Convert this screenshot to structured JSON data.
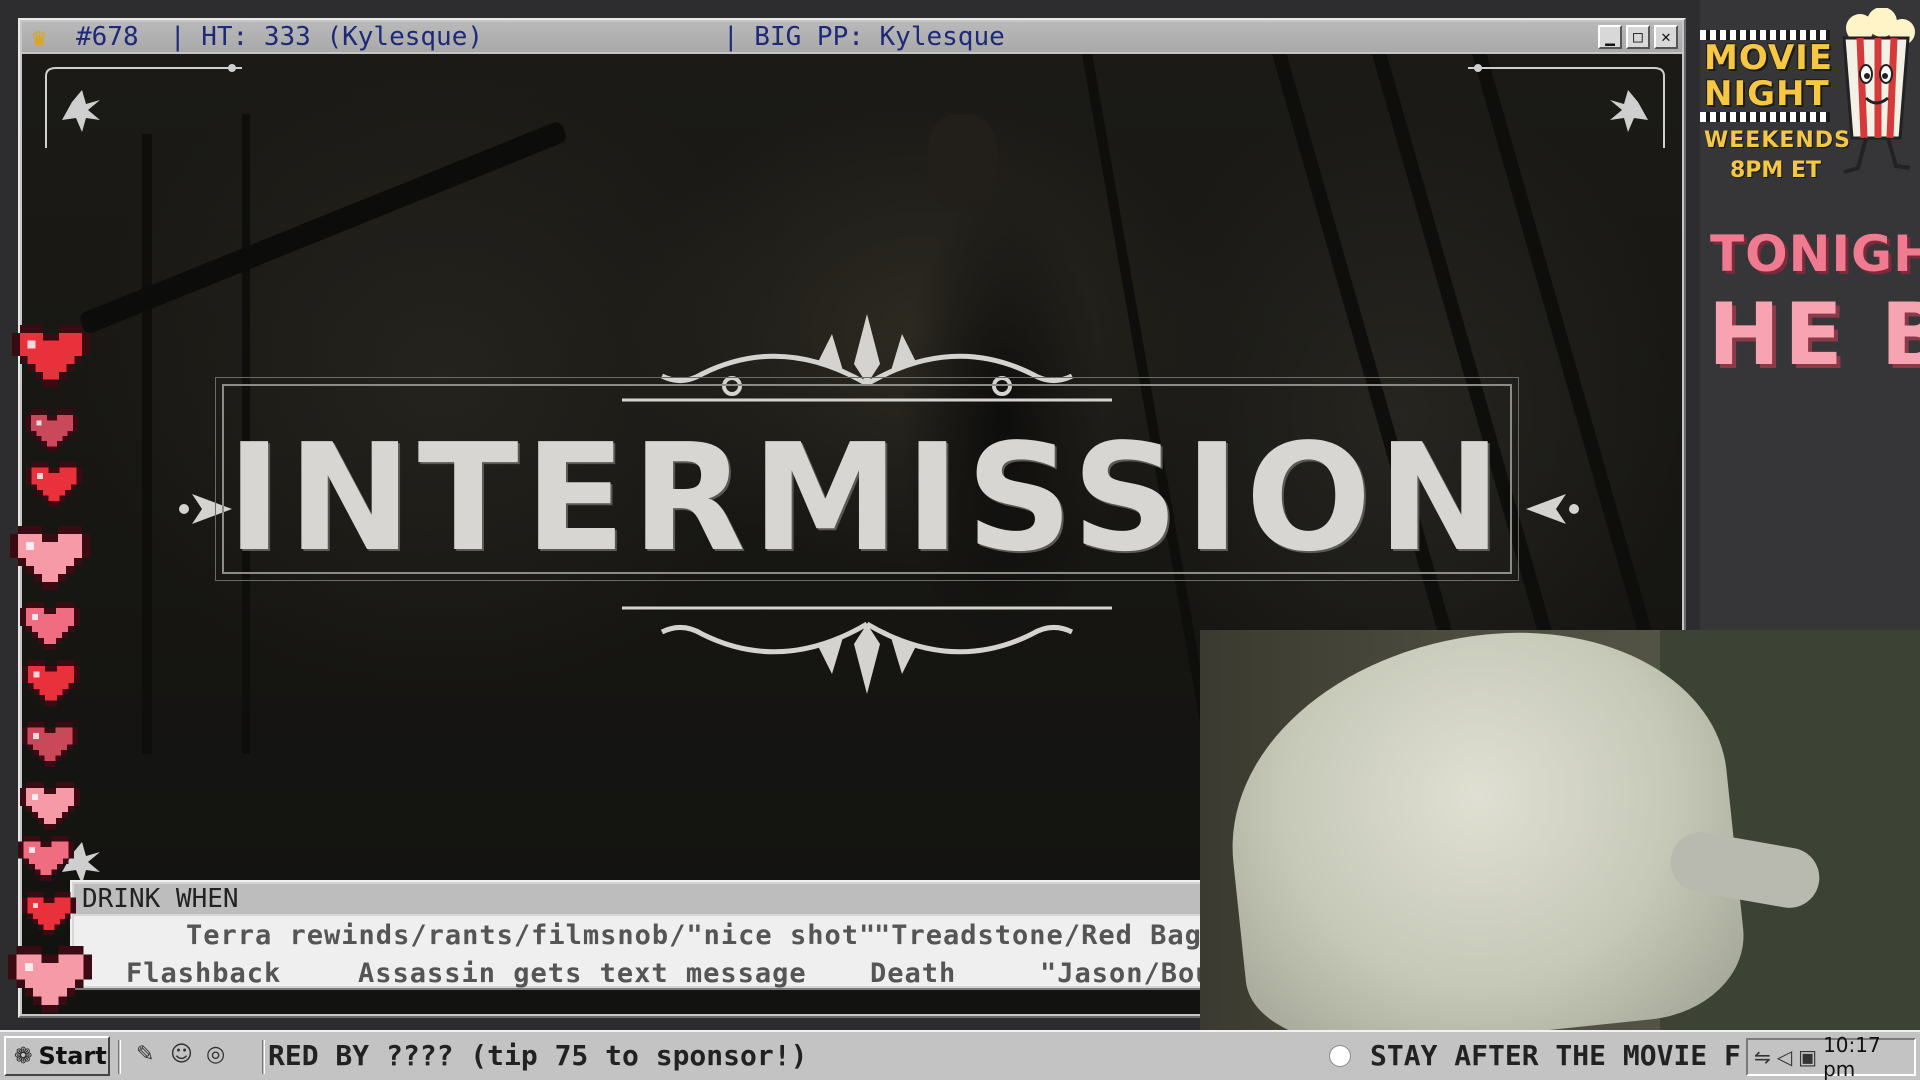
{
  "window": {
    "title_counter": "#678",
    "title_ht": "  | HT: 333 (Kylesque)",
    "title_pp": "| BIG PP: Kylesque",
    "buttons": {
      "minimize": "▁",
      "maximize": "□",
      "close": "✕"
    }
  },
  "video": {
    "banner_text": "INTERMISSION"
  },
  "drink_when": {
    "title": "DRINK WHEN",
    "items": [
      "Terra rewinds/rants/filmsnob/\"nice shot\"",
      "\"Treadstone/Red Bag\"",
      "Flashback",
      "Assassin gets text message",
      "Death",
      "\"Jason/Bourne\""
    ]
  },
  "sidebar": {
    "movie_night_line1": "MOVIE",
    "movie_night_line2": "NIGHT",
    "weekends": "WEEKENDS",
    "time": "8PM ET",
    "tonight": "TONIGHT:",
    "tonight_title": "HE B"
  },
  "hearts": [
    {
      "color": "#e8313b"
    },
    {
      "color": "#c9485a"
    },
    {
      "color": "#e8313b"
    },
    {
      "color": "#f79aa8"
    },
    {
      "color": "#f06c80"
    },
    {
      "color": "#e8313b"
    },
    {
      "color": "#c9485a"
    },
    {
      "color": "#f79aa8"
    },
    {
      "color": "#f06c80"
    },
    {
      "color": "#e8313b"
    },
    {
      "color": "#f79aa8"
    }
  ],
  "taskbar": {
    "start_label": "Start",
    "ticker_left": "RED BY ???? (tip 75 to sponsor!)",
    "ticker_right": "STAY AFTER THE MOVIE F",
    "clock": "10:17 pm"
  },
  "colors": {
    "accent_yellow": "#f5c743",
    "accent_pink": "#f07a90",
    "titlebar_text": "#1e2a78"
  }
}
